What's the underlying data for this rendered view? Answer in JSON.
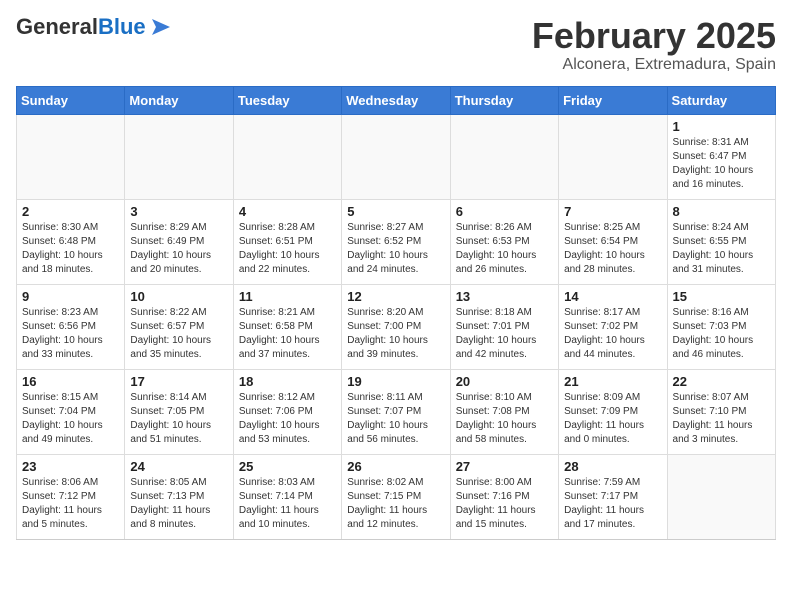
{
  "header": {
    "logo_general": "General",
    "logo_blue": "Blue",
    "month_title": "February 2025",
    "location": "Alconera, Extremadura, Spain"
  },
  "weekdays": [
    "Sunday",
    "Monday",
    "Tuesday",
    "Wednesday",
    "Thursday",
    "Friday",
    "Saturday"
  ],
  "weeks": [
    [
      {
        "day": "",
        "info": ""
      },
      {
        "day": "",
        "info": ""
      },
      {
        "day": "",
        "info": ""
      },
      {
        "day": "",
        "info": ""
      },
      {
        "day": "",
        "info": ""
      },
      {
        "day": "",
        "info": ""
      },
      {
        "day": "1",
        "info": "Sunrise: 8:31 AM\nSunset: 6:47 PM\nDaylight: 10 hours and 16 minutes."
      }
    ],
    [
      {
        "day": "2",
        "info": "Sunrise: 8:30 AM\nSunset: 6:48 PM\nDaylight: 10 hours and 18 minutes."
      },
      {
        "day": "3",
        "info": "Sunrise: 8:29 AM\nSunset: 6:49 PM\nDaylight: 10 hours and 20 minutes."
      },
      {
        "day": "4",
        "info": "Sunrise: 8:28 AM\nSunset: 6:51 PM\nDaylight: 10 hours and 22 minutes."
      },
      {
        "day": "5",
        "info": "Sunrise: 8:27 AM\nSunset: 6:52 PM\nDaylight: 10 hours and 24 minutes."
      },
      {
        "day": "6",
        "info": "Sunrise: 8:26 AM\nSunset: 6:53 PM\nDaylight: 10 hours and 26 minutes."
      },
      {
        "day": "7",
        "info": "Sunrise: 8:25 AM\nSunset: 6:54 PM\nDaylight: 10 hours and 28 minutes."
      },
      {
        "day": "8",
        "info": "Sunrise: 8:24 AM\nSunset: 6:55 PM\nDaylight: 10 hours and 31 minutes."
      }
    ],
    [
      {
        "day": "9",
        "info": "Sunrise: 8:23 AM\nSunset: 6:56 PM\nDaylight: 10 hours and 33 minutes."
      },
      {
        "day": "10",
        "info": "Sunrise: 8:22 AM\nSunset: 6:57 PM\nDaylight: 10 hours and 35 minutes."
      },
      {
        "day": "11",
        "info": "Sunrise: 8:21 AM\nSunset: 6:58 PM\nDaylight: 10 hours and 37 minutes."
      },
      {
        "day": "12",
        "info": "Sunrise: 8:20 AM\nSunset: 7:00 PM\nDaylight: 10 hours and 39 minutes."
      },
      {
        "day": "13",
        "info": "Sunrise: 8:18 AM\nSunset: 7:01 PM\nDaylight: 10 hours and 42 minutes."
      },
      {
        "day": "14",
        "info": "Sunrise: 8:17 AM\nSunset: 7:02 PM\nDaylight: 10 hours and 44 minutes."
      },
      {
        "day": "15",
        "info": "Sunrise: 8:16 AM\nSunset: 7:03 PM\nDaylight: 10 hours and 46 minutes."
      }
    ],
    [
      {
        "day": "16",
        "info": "Sunrise: 8:15 AM\nSunset: 7:04 PM\nDaylight: 10 hours and 49 minutes."
      },
      {
        "day": "17",
        "info": "Sunrise: 8:14 AM\nSunset: 7:05 PM\nDaylight: 10 hours and 51 minutes."
      },
      {
        "day": "18",
        "info": "Sunrise: 8:12 AM\nSunset: 7:06 PM\nDaylight: 10 hours and 53 minutes."
      },
      {
        "day": "19",
        "info": "Sunrise: 8:11 AM\nSunset: 7:07 PM\nDaylight: 10 hours and 56 minutes."
      },
      {
        "day": "20",
        "info": "Sunrise: 8:10 AM\nSunset: 7:08 PM\nDaylight: 10 hours and 58 minutes."
      },
      {
        "day": "21",
        "info": "Sunrise: 8:09 AM\nSunset: 7:09 PM\nDaylight: 11 hours and 0 minutes."
      },
      {
        "day": "22",
        "info": "Sunrise: 8:07 AM\nSunset: 7:10 PM\nDaylight: 11 hours and 3 minutes."
      }
    ],
    [
      {
        "day": "23",
        "info": "Sunrise: 8:06 AM\nSunset: 7:12 PM\nDaylight: 11 hours and 5 minutes."
      },
      {
        "day": "24",
        "info": "Sunrise: 8:05 AM\nSunset: 7:13 PM\nDaylight: 11 hours and 8 minutes."
      },
      {
        "day": "25",
        "info": "Sunrise: 8:03 AM\nSunset: 7:14 PM\nDaylight: 11 hours and 10 minutes."
      },
      {
        "day": "26",
        "info": "Sunrise: 8:02 AM\nSunset: 7:15 PM\nDaylight: 11 hours and 12 minutes."
      },
      {
        "day": "27",
        "info": "Sunrise: 8:00 AM\nSunset: 7:16 PM\nDaylight: 11 hours and 15 minutes."
      },
      {
        "day": "28",
        "info": "Sunrise: 7:59 AM\nSunset: 7:17 PM\nDaylight: 11 hours and 17 minutes."
      },
      {
        "day": "",
        "info": ""
      }
    ]
  ]
}
